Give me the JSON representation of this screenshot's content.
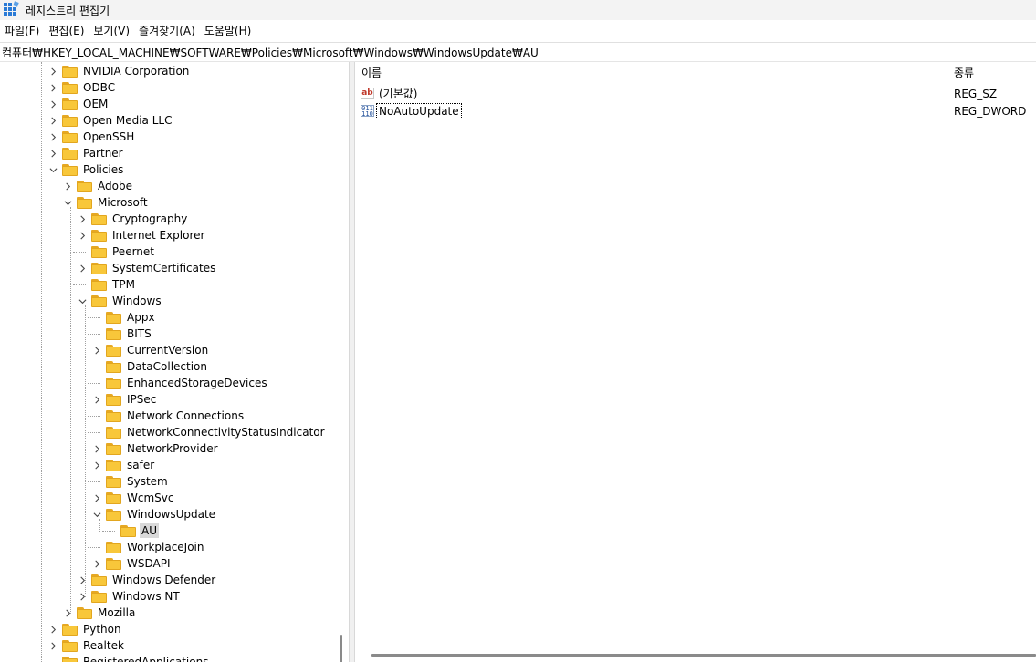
{
  "window": {
    "title": "레지스트리 편집기"
  },
  "menu": [
    "파일(F)",
    "편집(E)",
    "보기(V)",
    "즐겨찾기(A)",
    "도움말(H)"
  ],
  "address": "컴퓨터₩HKEY_LOCAL_MACHINE₩SOFTWARE₩Policies₩Microsoft₩Windows₩WindowsUpdate₩AU",
  "tree": [
    {
      "label": "NVIDIA Corporation",
      "depth": 0,
      "expander": "collapsed"
    },
    {
      "label": "ODBC",
      "depth": 0,
      "expander": "collapsed"
    },
    {
      "label": "OEM",
      "depth": 0,
      "expander": "collapsed"
    },
    {
      "label": "Open Media LLC",
      "depth": 0,
      "expander": "collapsed"
    },
    {
      "label": "OpenSSH",
      "depth": 0,
      "expander": "collapsed"
    },
    {
      "label": "Partner",
      "depth": 0,
      "expander": "collapsed"
    },
    {
      "label": "Policies",
      "depth": 0,
      "expander": "expanded"
    },
    {
      "label": "Adobe",
      "depth": 1,
      "expander": "collapsed"
    },
    {
      "label": "Microsoft",
      "depth": 1,
      "expander": "expanded"
    },
    {
      "label": "Cryptography",
      "depth": 2,
      "expander": "collapsed"
    },
    {
      "label": "Internet Explorer",
      "depth": 2,
      "expander": "collapsed"
    },
    {
      "label": "Peernet",
      "depth": 2,
      "expander": "none"
    },
    {
      "label": "SystemCertificates",
      "depth": 2,
      "expander": "collapsed"
    },
    {
      "label": "TPM",
      "depth": 2,
      "expander": "none"
    },
    {
      "label": "Windows",
      "depth": 2,
      "expander": "expanded"
    },
    {
      "label": "Appx",
      "depth": 3,
      "expander": "none"
    },
    {
      "label": "BITS",
      "depth": 3,
      "expander": "none"
    },
    {
      "label": "CurrentVersion",
      "depth": 3,
      "expander": "collapsed"
    },
    {
      "label": "DataCollection",
      "depth": 3,
      "expander": "none"
    },
    {
      "label": "EnhancedStorageDevices",
      "depth": 3,
      "expander": "none"
    },
    {
      "label": "IPSec",
      "depth": 3,
      "expander": "collapsed"
    },
    {
      "label": "Network Connections",
      "depth": 3,
      "expander": "none"
    },
    {
      "label": "NetworkConnectivityStatusIndicator",
      "depth": 3,
      "expander": "none"
    },
    {
      "label": "NetworkProvider",
      "depth": 3,
      "expander": "collapsed"
    },
    {
      "label": "safer",
      "depth": 3,
      "expander": "collapsed"
    },
    {
      "label": "System",
      "depth": 3,
      "expander": "none"
    },
    {
      "label": "WcmSvc",
      "depth": 3,
      "expander": "collapsed"
    },
    {
      "label": "WindowsUpdate",
      "depth": 3,
      "expander": "expanded"
    },
    {
      "label": "AU",
      "depth": 4,
      "expander": "none",
      "selected": true
    },
    {
      "label": "WorkplaceJoin",
      "depth": 3,
      "expander": "none"
    },
    {
      "label": "WSDAPI",
      "depth": 3,
      "expander": "collapsed"
    },
    {
      "label": "Windows Defender",
      "depth": 2,
      "expander": "collapsed"
    },
    {
      "label": "Windows NT",
      "depth": 2,
      "expander": "collapsed"
    },
    {
      "label": "Mozilla",
      "depth": 1,
      "expander": "collapsed"
    },
    {
      "label": "Python",
      "depth": 0,
      "expander": "collapsed"
    },
    {
      "label": "Realtek",
      "depth": 0,
      "expander": "collapsed"
    },
    {
      "label": "RegisteredApplications",
      "depth": 0,
      "expander": "none"
    }
  ],
  "values_pane": {
    "columns": {
      "name": "이름",
      "type": "종류"
    },
    "rows": [
      {
        "name": "(기본값)",
        "type": "REG_SZ",
        "icon": "string-value-icon",
        "icon_text": "ab"
      },
      {
        "name": "NoAutoUpdate",
        "type": "REG_DWORD",
        "icon": "binary-value-icon",
        "icon_text": "011\n110"
      }
    ]
  }
}
